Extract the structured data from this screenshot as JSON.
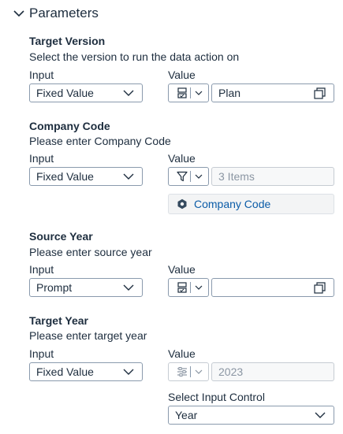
{
  "panel": {
    "section_title": "Parameters",
    "section_icon": "chevron-down-icon"
  },
  "labels": {
    "input": "Input",
    "value": "Value"
  },
  "params": [
    {
      "title": "Target Version",
      "description": "Select the version to run the data action on",
      "input_type": "Fixed Value",
      "value_type_icon": "member-selector-icon",
      "value": "Plan",
      "value_action_icon": "copy-icon"
    },
    {
      "title": "Company Code",
      "description": "Please enter Company Code",
      "input_type": "Fixed Value",
      "value_type_icon": "filter-icon",
      "value": "3 Items",
      "value_disabled": true,
      "token_label": "Company Code",
      "token_icon": "dimension-icon"
    },
    {
      "title": "Source Year",
      "description": "Please enter source year",
      "input_type": "Prompt",
      "value_type_icon": "member-selector-icon",
      "value": "",
      "value_action_icon": "copy-icon"
    },
    {
      "title": "Target Year",
      "description": "Please enter target year",
      "input_type": "Fixed Value",
      "value_type_icon": "input-control-icon",
      "value": "2023",
      "value_disabled": true,
      "input_control_label": "Select Input Control",
      "input_control_value": "Year"
    }
  ],
  "colors": {
    "text": "#1d2d3e",
    "border": "#8a9aad",
    "disabled_border": "#c6ccd3",
    "disabled_text": "#8b96a3",
    "token_text": "#0b5ca8",
    "token_bg": "#f3f4f5"
  }
}
